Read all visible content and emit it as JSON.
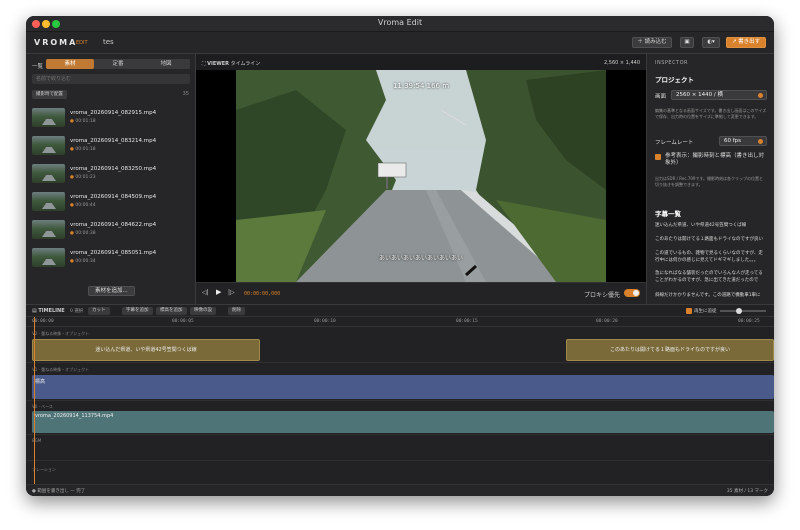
{
  "window": {
    "title": "Vroma Edit"
  },
  "toolbar": {
    "brand": "VROMA",
    "mode": "EDIT",
    "project_name": "tes",
    "import_label": "＋ 読み込む",
    "export_label": "↗ 書き出す"
  },
  "left": {
    "header": "一覧",
    "tabs": [
      "素材",
      "定番",
      "地図"
    ],
    "search_placeholder": "名前で絞り込む",
    "sort_label": "撮影時で配置",
    "count": "35",
    "clips": [
      {
        "name": "vroma_20260914_082915.mp4",
        "dur": "00:01:18"
      },
      {
        "name": "vroma_20260914_083214.mp4",
        "dur": "00:01:18"
      },
      {
        "name": "vroma_20260914_083250.mp4",
        "dur": "00:01:23"
      },
      {
        "name": "vroma_20260914_084509.mp4",
        "dur": "00:00:44"
      },
      {
        "name": "vroma_20260914_084622.mp4",
        "dur": "00:00:38"
      },
      {
        "name": "vroma_20260914_085051.mp4",
        "dur": "00:00:34"
      }
    ],
    "add_label": "素材を追加..."
  },
  "viewer": {
    "label": "VIEWER",
    "sublabel": "タイムライン",
    "resolution": "2,560 × 1,440",
    "overlay": "11:39:54  166 m",
    "subtitle": "あいあいあいあいあいあいあい",
    "timecode": "00:00:00,000",
    "proxy_label": "プロキシ優先"
  },
  "inspector": {
    "title": "INSPECTOR",
    "project_heading": "プロジェクト",
    "canvas_label": "画面",
    "canvas_value": "2560 × 1440 / 横",
    "canvas_note": "編集の基準となる画面サイズです。書き出し画面はこのサイズで保存、出力時の位置をサイズに準拠して変更できます。",
    "fps_label": "フレームレート",
    "fps_value": "60 fps",
    "ref_label": "参考表示：撮影時刻と標高（書き出し対象外）",
    "ref_note": "出力はSDR / Rec.709です。撮影時刻は各クリップの位置と切り抜きを調整できます。",
    "subs_heading": "字幕一覧",
    "subs": [
      "迷い込んだ県道、いや県道42号笠間つくば線",
      "このあたりは開けてる１路面もドライなのですが良い",
      "この道でいるもの、雑物で見るくらいなのですが、走行中には何かの感じに見えてドギマギしました。。。",
      "急になればなる舗装だったのでいろんな人が走ってることがわかるのですが、急に出てきた道だったので",
      "斜線だけかかりませんです。この道路で機動車1車に"
    ]
  },
  "timeline": {
    "label": "TIMELINE",
    "count_label": "0 選択",
    "snap_label": "カット",
    "add_sub_label": "字幕を追加",
    "add_ele_label": "標高を追加",
    "cam_label": "映像の設",
    "delete_label": "削除",
    "live_label": "再生に追従",
    "ruler": [
      "00:00:00",
      "00:00:05",
      "00:00:10",
      "00:00:15",
      "00:00:20",
      "00:00:25"
    ],
    "track_v2": "V2 · 重ねる映像・オブジェクト",
    "track_v1": "V1 · 重ねる映像・オブジェクト",
    "track_v0": "V0 · ベース",
    "track_bgm": "BGM",
    "track_narr": "ナレーション",
    "sub_clips": [
      "迷い込んだ県道、いや県道42号笠間つくば線",
      "このあたりは開けてる１路面もドライなのですが良い"
    ],
    "ele_clip": "標高",
    "base_clip": "vroma_20260914_113754.mp4"
  },
  "status": {
    "left": "● 範囲を書き出し — 完了",
    "right": "35 素材  /  13 マーク"
  }
}
